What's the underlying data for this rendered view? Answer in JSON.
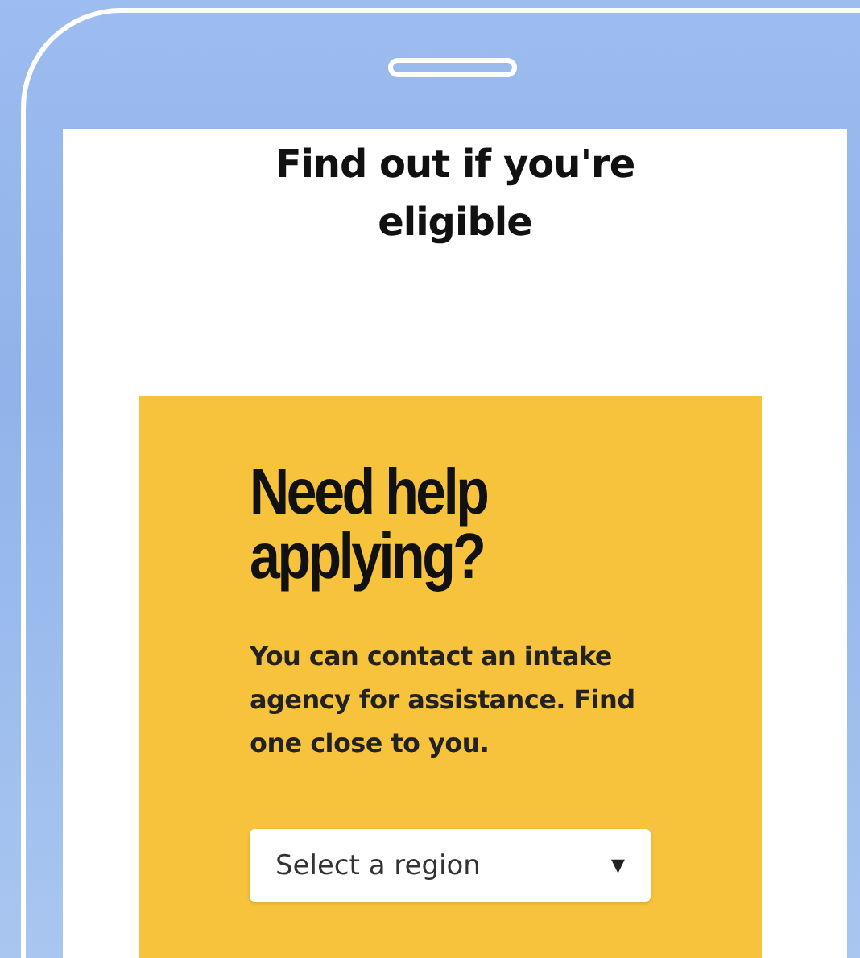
{
  "page": {
    "heading": "Find out if you're eligible"
  },
  "help_card": {
    "title": "Need help applying?",
    "text": "You can contact an intake agency for assistance. Find one close to you.",
    "region_select": {
      "placeholder": "Select a region",
      "caret": "▼"
    }
  }
}
